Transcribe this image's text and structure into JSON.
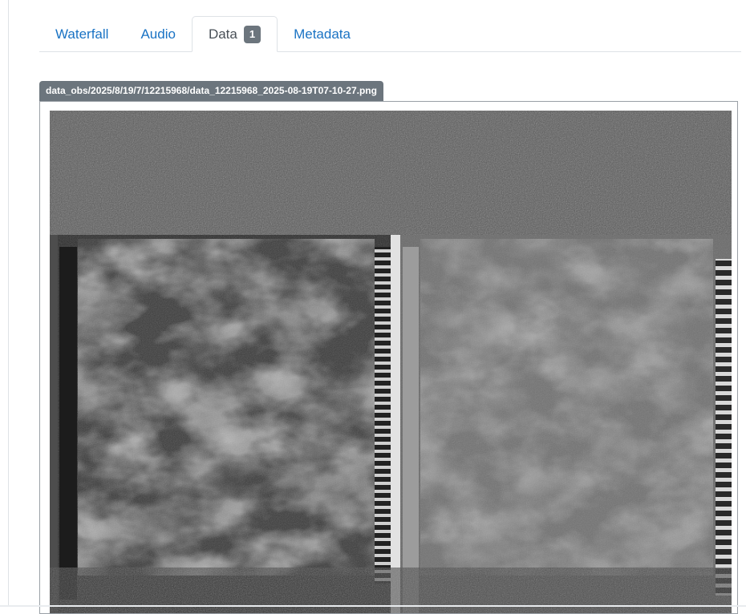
{
  "tabs": [
    {
      "label": "Waterfall"
    },
    {
      "label": "Audio"
    },
    {
      "label": "Data",
      "badge": "1",
      "active": true
    },
    {
      "label": "Metadata"
    }
  ],
  "data_panel": {
    "file_path": "data_obs/2025/8/19/7/12215968/data_12215968_2025-08-19T07-10-27.png"
  },
  "colors": {
    "link": "#1a73c4",
    "badge_bg": "#6c757d",
    "border": "#dee2e6"
  }
}
